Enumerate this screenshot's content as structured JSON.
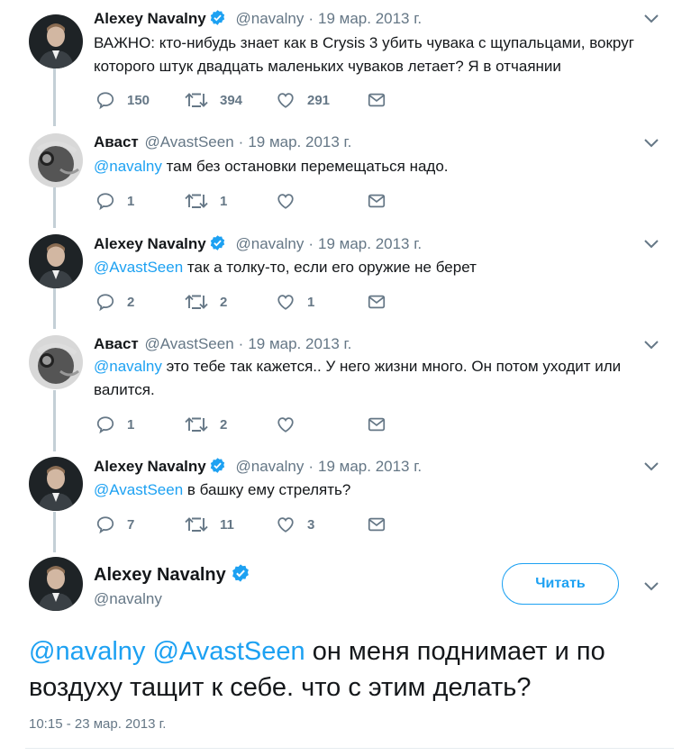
{
  "tweets": [
    {
      "name": "Alexey Navalny",
      "verified": true,
      "handle": "@navalny",
      "date": "19 мар. 2013 г.",
      "mention": "",
      "text": "ВАЖНО: кто-нибудь знает как в Crysis 3 убить чувака с щупальцами, вокруг которого штук двадцать маленьких чуваков летает? Я в отчаянии",
      "replies": "150",
      "retweets": "394",
      "likes": "291"
    },
    {
      "name": "Аваст",
      "verified": false,
      "handle": "@AvastSeen",
      "date": "19 мар. 2013 г.",
      "mention": "@navalny",
      "text": " там без остановки перемещаться надо.",
      "replies": "1",
      "retweets": "1",
      "likes": ""
    },
    {
      "name": "Alexey Navalny",
      "verified": true,
      "handle": "@navalny",
      "date": "19 мар. 2013 г.",
      "mention": "@AvastSeen",
      "text": " так а толку-то, если его оружие не берет",
      "replies": "2",
      "retweets": "2",
      "likes": "1"
    },
    {
      "name": "Аваст",
      "verified": false,
      "handle": "@AvastSeen",
      "date": "19 мар. 2013 г.",
      "mention": "@navalny",
      "text": " это тебе так кажется.. У него жизни много. Он потом уходит или валится.",
      "replies": "1",
      "retweets": "2",
      "likes": ""
    },
    {
      "name": "Alexey Navalny",
      "verified": true,
      "handle": "@navalny",
      "date": "19 мар. 2013 г.",
      "mention": "@AvastSeen",
      "text": " в башку ему стрелять?",
      "replies": "7",
      "retweets": "11",
      "likes": "3"
    }
  ],
  "main": {
    "name": "Alexey Navalny",
    "handle": "@navalny",
    "follow_label": "Читать",
    "mention1": "@navalny",
    "mention2": "@AvastSeen",
    "text": " он меня поднимает и по воздуху тащит к себе. что с этим делать?",
    "timestamp": "10:15 - 23 мар. 2013 г."
  },
  "colors": {
    "accent": "#1da1f2",
    "muted": "#657786",
    "thread": "#c4cfd6"
  },
  "icons": {
    "reply": "reply-icon",
    "retweet": "retweet-icon",
    "like": "heart-icon",
    "message": "envelope-icon",
    "more": "chevron-down-icon",
    "verified": "verified-badge-icon"
  }
}
